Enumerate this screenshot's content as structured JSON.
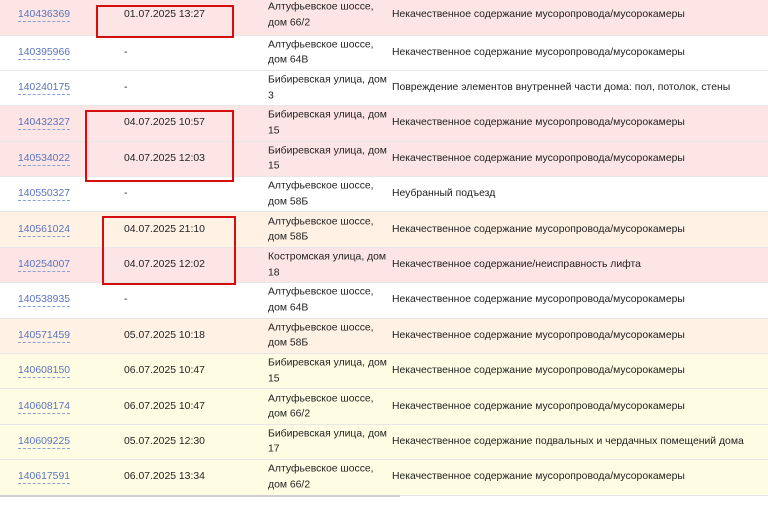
{
  "rows": [
    {
      "id": "140436369",
      "date": "01.07.2025 13:27",
      "address": "Алтуфьевское шоссе, дом 66/2",
      "description": "Некачественное содержание мусоропровода/мусорокамеры",
      "color": "pink"
    },
    {
      "id": "140395966",
      "date": "-",
      "address": "Алтуфьевское шоссе, дом 64В",
      "description": "Некачественное содержание мусоропровода/мусорокамеры",
      "color": "white"
    },
    {
      "id": "140240175",
      "date": "-",
      "address": "Бибиревская улица, дом 3",
      "description": "Повреждение элементов внутренней части дома: пол, потолок, стены",
      "color": "white"
    },
    {
      "id": "140432327",
      "date": "04.07.2025 10:57",
      "address": "Бибиревская улица, дом 15",
      "description": "Некачественное содержание мусоропровода/мусорокамеры",
      "color": "pink"
    },
    {
      "id": "140534022",
      "date": "04.07.2025 12:03",
      "address": "Бибиревская улица, дом 15",
      "description": "Некачественное содержание мусоропровода/мусорокамеры",
      "color": "pink"
    },
    {
      "id": "140550327",
      "date": "-",
      "address": "Алтуфьевское шоссе, дом 58Б",
      "description": "Неубранный подъезд",
      "color": "white"
    },
    {
      "id": "140561024",
      "date": "04.07.2025 21:10",
      "address": "Алтуфьевское шоссе, дом 58Б",
      "description": "Некачественное содержание мусоропровода/мусорокамеры",
      "color": "peach"
    },
    {
      "id": "140254007",
      "date": "04.07.2025 12:02",
      "address": "Костромская улица, дом 18",
      "description": "Некачественное содержание/неисправность лифта",
      "color": "pink"
    },
    {
      "id": "140538935",
      "date": "-",
      "address": "Алтуфьевское шоссе, дом 64В",
      "description": "Некачественное содержание мусоропровода/мусорокамеры",
      "color": "white"
    },
    {
      "id": "140571459",
      "date": "05.07.2025 10:18",
      "address": "Алтуфьевское шоссе, дом 58Б",
      "description": "Некачественное содержание мусоропровода/мусорокамеры",
      "color": "peach"
    },
    {
      "id": "140608150",
      "date": "06.07.2025 10:47",
      "address": "Бибиревская улица, дом 15",
      "description": "Некачественное содержание мусоропровода/мусорокамеры",
      "color": "yellow"
    },
    {
      "id": "140608174",
      "date": "06.07.2025 10:47",
      "address": "Алтуфьевское шоссе, дом 66/2",
      "description": "Некачественное содержание мусоропровода/мусорокамеры",
      "color": "yellow"
    },
    {
      "id": "140609225",
      "date": "05.07.2025 12:30",
      "address": "Бибиревская улица, дом 17",
      "description": "Некачественное содержание подвальных и чердачных помещений дома",
      "color": "yellow"
    },
    {
      "id": "140617591",
      "date": "06.07.2025 13:34",
      "address": "Алтуфьевское шоссе, дом 66/2",
      "description": "Некачественное содержание мусоропровода/мусорокамеры",
      "color": "yellow"
    }
  ],
  "highlight_color": "#d50d0d"
}
